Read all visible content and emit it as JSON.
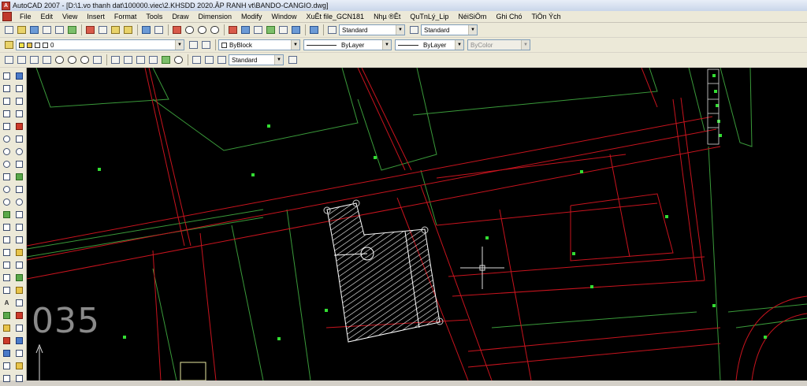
{
  "window": {
    "title": "AutoCAD 2007 - [D:\\1.vo thanh dat\\100000.viec\\2.KHSDD 2020.ÂP RANH vt\\BANDO-CANGIO.dwg]"
  },
  "menu": [
    "File",
    "Edit",
    "View",
    "Insert",
    "Format",
    "Tools",
    "Draw",
    "Dimension",
    "Modify",
    "Window",
    "XuÊt file_GCN181",
    "Nhµ ®Êt",
    "QuTnLý_Lip",
    "NéiSiÖm",
    "Ghi Chó",
    "TiÖn Ých"
  ],
  "styles": {
    "text_style": "Standard",
    "dim_style": "Standard",
    "table_style": "Standard"
  },
  "layer": {
    "current": "0"
  },
  "properties": {
    "color": "ByBlock",
    "linetype": "ByLayer",
    "lineweight": "ByLayer",
    "plotstyle": "ByColor"
  },
  "canvas": {
    "view_label": "035"
  },
  "colors": {
    "background": "#000000",
    "parcel_red": "#c8141e",
    "parcel_green": "#3a9a3a",
    "point_green": "#33dd33",
    "hatch": "#ffffff"
  }
}
